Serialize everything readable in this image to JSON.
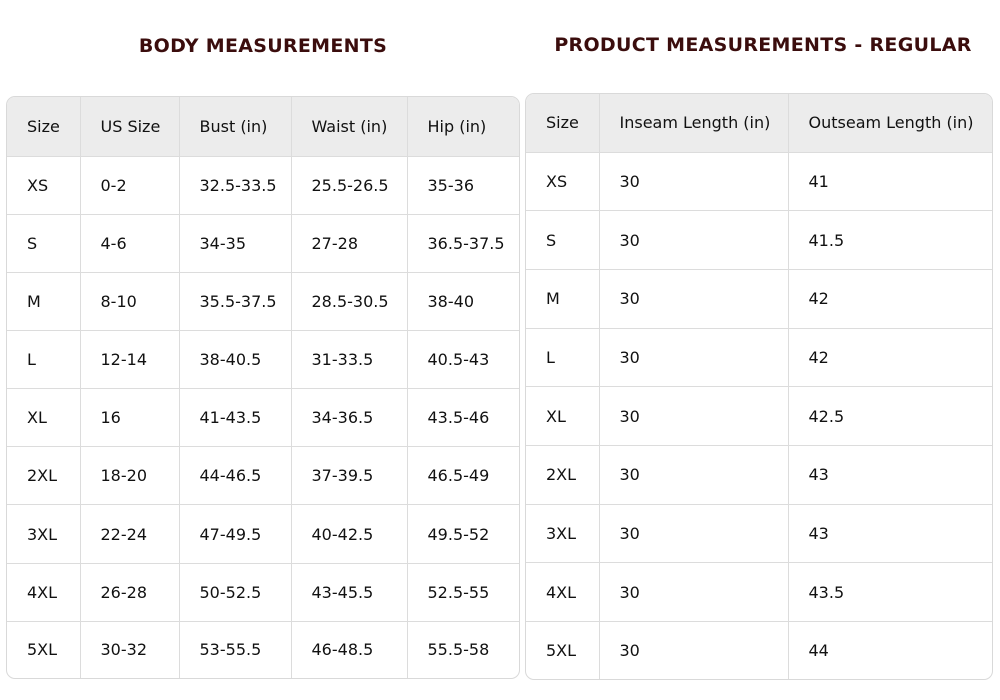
{
  "body": {
    "title": "BODY MEASUREMENTS",
    "headers": [
      "Size",
      "US Size",
      "Bust (in)",
      "Waist (in)",
      "Hip (in)"
    ],
    "rows": [
      [
        "XS",
        "0-2",
        "32.5-33.5",
        "25.5-26.5",
        "35-36"
      ],
      [
        "S",
        "4-6",
        "34-35",
        "27-28",
        "36.5-37.5"
      ],
      [
        "M",
        "8-10",
        "35.5-37.5",
        "28.5-30.5",
        "38-40"
      ],
      [
        "L",
        "12-14",
        "38-40.5",
        "31-33.5",
        "40.5-43"
      ],
      [
        "XL",
        "16",
        "41-43.5",
        "34-36.5",
        "43.5-46"
      ],
      [
        "2XL",
        "18-20",
        "44-46.5",
        "37-39.5",
        "46.5-49"
      ],
      [
        "3XL",
        "22-24",
        "47-49.5",
        "40-42.5",
        "49.5-52"
      ],
      [
        "4XL",
        "26-28",
        "50-52.5",
        "43-45.5",
        "52.5-55"
      ],
      [
        "5XL",
        "30-32",
        "53-55.5",
        "46-48.5",
        "55.5-58"
      ]
    ]
  },
  "product": {
    "title": "PRODUCT MEASUREMENTS - REGULAR",
    "headers": [
      "Size",
      "Inseam Length (in)",
      "Outseam Length (in)"
    ],
    "rows": [
      [
        "XS",
        "30",
        "41"
      ],
      [
        "S",
        "30",
        "41.5"
      ],
      [
        "M",
        "30",
        "42"
      ],
      [
        "L",
        "30",
        "42"
      ],
      [
        "XL",
        "30",
        "42.5"
      ],
      [
        "2XL",
        "30",
        "43"
      ],
      [
        "3XL",
        "30",
        "43"
      ],
      [
        "4XL",
        "30",
        "43.5"
      ],
      [
        "5XL",
        "30",
        "44"
      ]
    ]
  },
  "colors": {
    "title": "#3b0d0d",
    "header_bg": "#ececec",
    "border": "#dcdcdc"
  }
}
